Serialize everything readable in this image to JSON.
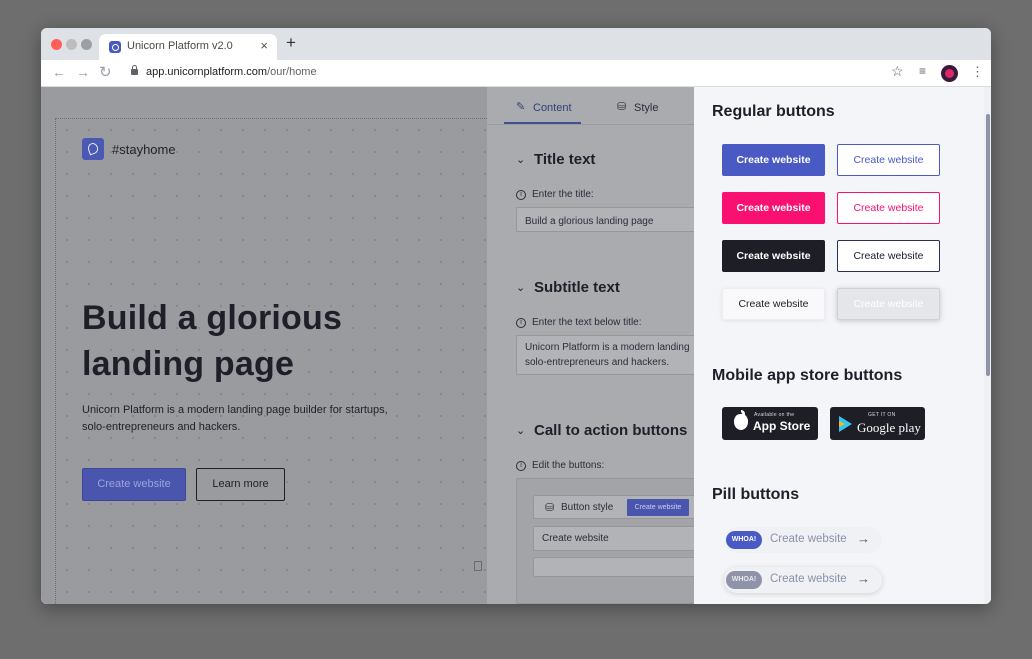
{
  "browser": {
    "tab_title": "Unicorn Platform v2.0",
    "new_tab": "+",
    "close": "×",
    "url_host": "app.unicornplatform.com",
    "url_path": "/our/home"
  },
  "preview": {
    "logo_text": "#stayhome",
    "title": "Build a glorious landing page",
    "description": "Unicorn Platform is a modern landing page builder for startups, solo-entrepreneurs and hackers.",
    "primary_button": "Create website",
    "secondary_button": "Learn more"
  },
  "editor": {
    "tabs": [
      {
        "label": "Content",
        "active": true
      },
      {
        "label": "Style",
        "active": false
      }
    ],
    "sections": {
      "title": {
        "heading": "Title text",
        "label": "Enter the title:",
        "value": "Build a glorious landing page"
      },
      "subtitle": {
        "heading": "Subtitle text",
        "label": "Enter the text below title:",
        "value_line1": "Unicorn Platform is a modern landing",
        "value_line2": "solo-entrepreneurs and hackers."
      },
      "cta": {
        "heading": "Call to action buttons",
        "label": "Edit the buttons:",
        "style_label": "Button style",
        "style_chip": "Create website",
        "button_text": "Create website"
      }
    }
  },
  "panel": {
    "regular_heading": "Regular buttons",
    "regular_buttons": [
      "Create website",
      "Create website",
      "Create website",
      "Create website",
      "Create website",
      "Create website",
      "Create website",
      "Create website"
    ],
    "store_heading": "Mobile app store buttons",
    "app_store": {
      "small": "Available on the",
      "big": "App Store"
    },
    "google_play": {
      "small": "GET IT ON",
      "big": "Google play"
    },
    "pill_heading": "Pill buttons",
    "pills": [
      {
        "badge": "WHOA!",
        "label": "Create website",
        "arrow": "→"
      },
      {
        "badge": "WHOA!",
        "label": "Create website",
        "arrow": "→"
      }
    ]
  },
  "colors": {
    "brand": "#4a5ac4",
    "pink": "#fa1070",
    "dark": "#1d1e26",
    "overlay": "#9a9b9e"
  }
}
